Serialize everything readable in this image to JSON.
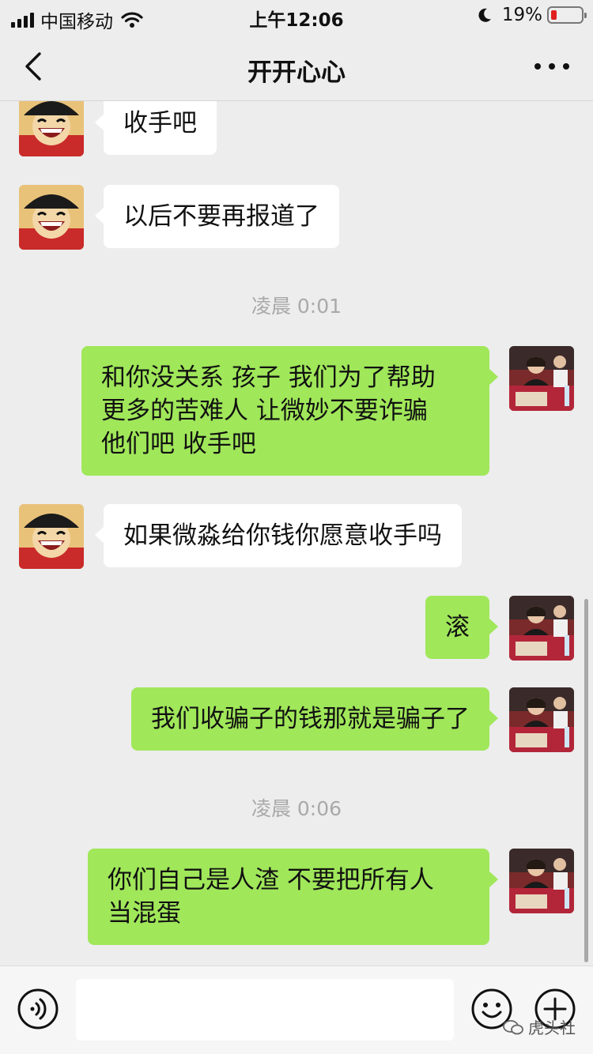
{
  "status_bar": {
    "carrier": "中国移动",
    "time": "上午12:06",
    "battery_percent": "19%",
    "battery_level": 0.19,
    "battery_color": "#e02020",
    "icons": [
      "signal-icon",
      "wifi-icon",
      "moon-icon",
      "battery-icon"
    ]
  },
  "nav": {
    "title": "开开心心",
    "back_icon": "chevron-left-icon",
    "more_icon": "more-dots-icon"
  },
  "messages": [
    {
      "side": "left",
      "text": "收手吧",
      "avatar": "cartoon-avatar"
    },
    {
      "side": "left",
      "text": "以后不要再报道了",
      "avatar": "cartoon-avatar"
    },
    {
      "timestamp": "凌晨 0:01"
    },
    {
      "side": "right",
      "text": "和你没关系 孩子 我们为了帮助\n更多的苦难人 让微妙不要诈骗\n他们吧 收手吧",
      "avatar": "photo-avatar"
    },
    {
      "side": "left",
      "text": "如果微淼给你钱你愿意收手吗",
      "avatar": "cartoon-avatar"
    },
    {
      "side": "right",
      "text": "滚",
      "avatar": "photo-avatar"
    },
    {
      "side": "right",
      "text": "我们收骗子的钱那就是骗子了",
      "avatar": "photo-avatar"
    },
    {
      "timestamp": "凌晨 0:06"
    },
    {
      "side": "right",
      "text": "你们自己是人渣 不要把所有人\n当混蛋",
      "avatar": "photo-avatar"
    }
  ],
  "input_bar": {
    "placeholder": "",
    "icons": [
      "voice-icon",
      "emoji-icon",
      "plus-icon"
    ]
  },
  "watermark": "虎头社",
  "colors": {
    "background": "#ededed",
    "sent_bubble": "#a0e75a",
    "received_bubble": "#ffffff"
  }
}
